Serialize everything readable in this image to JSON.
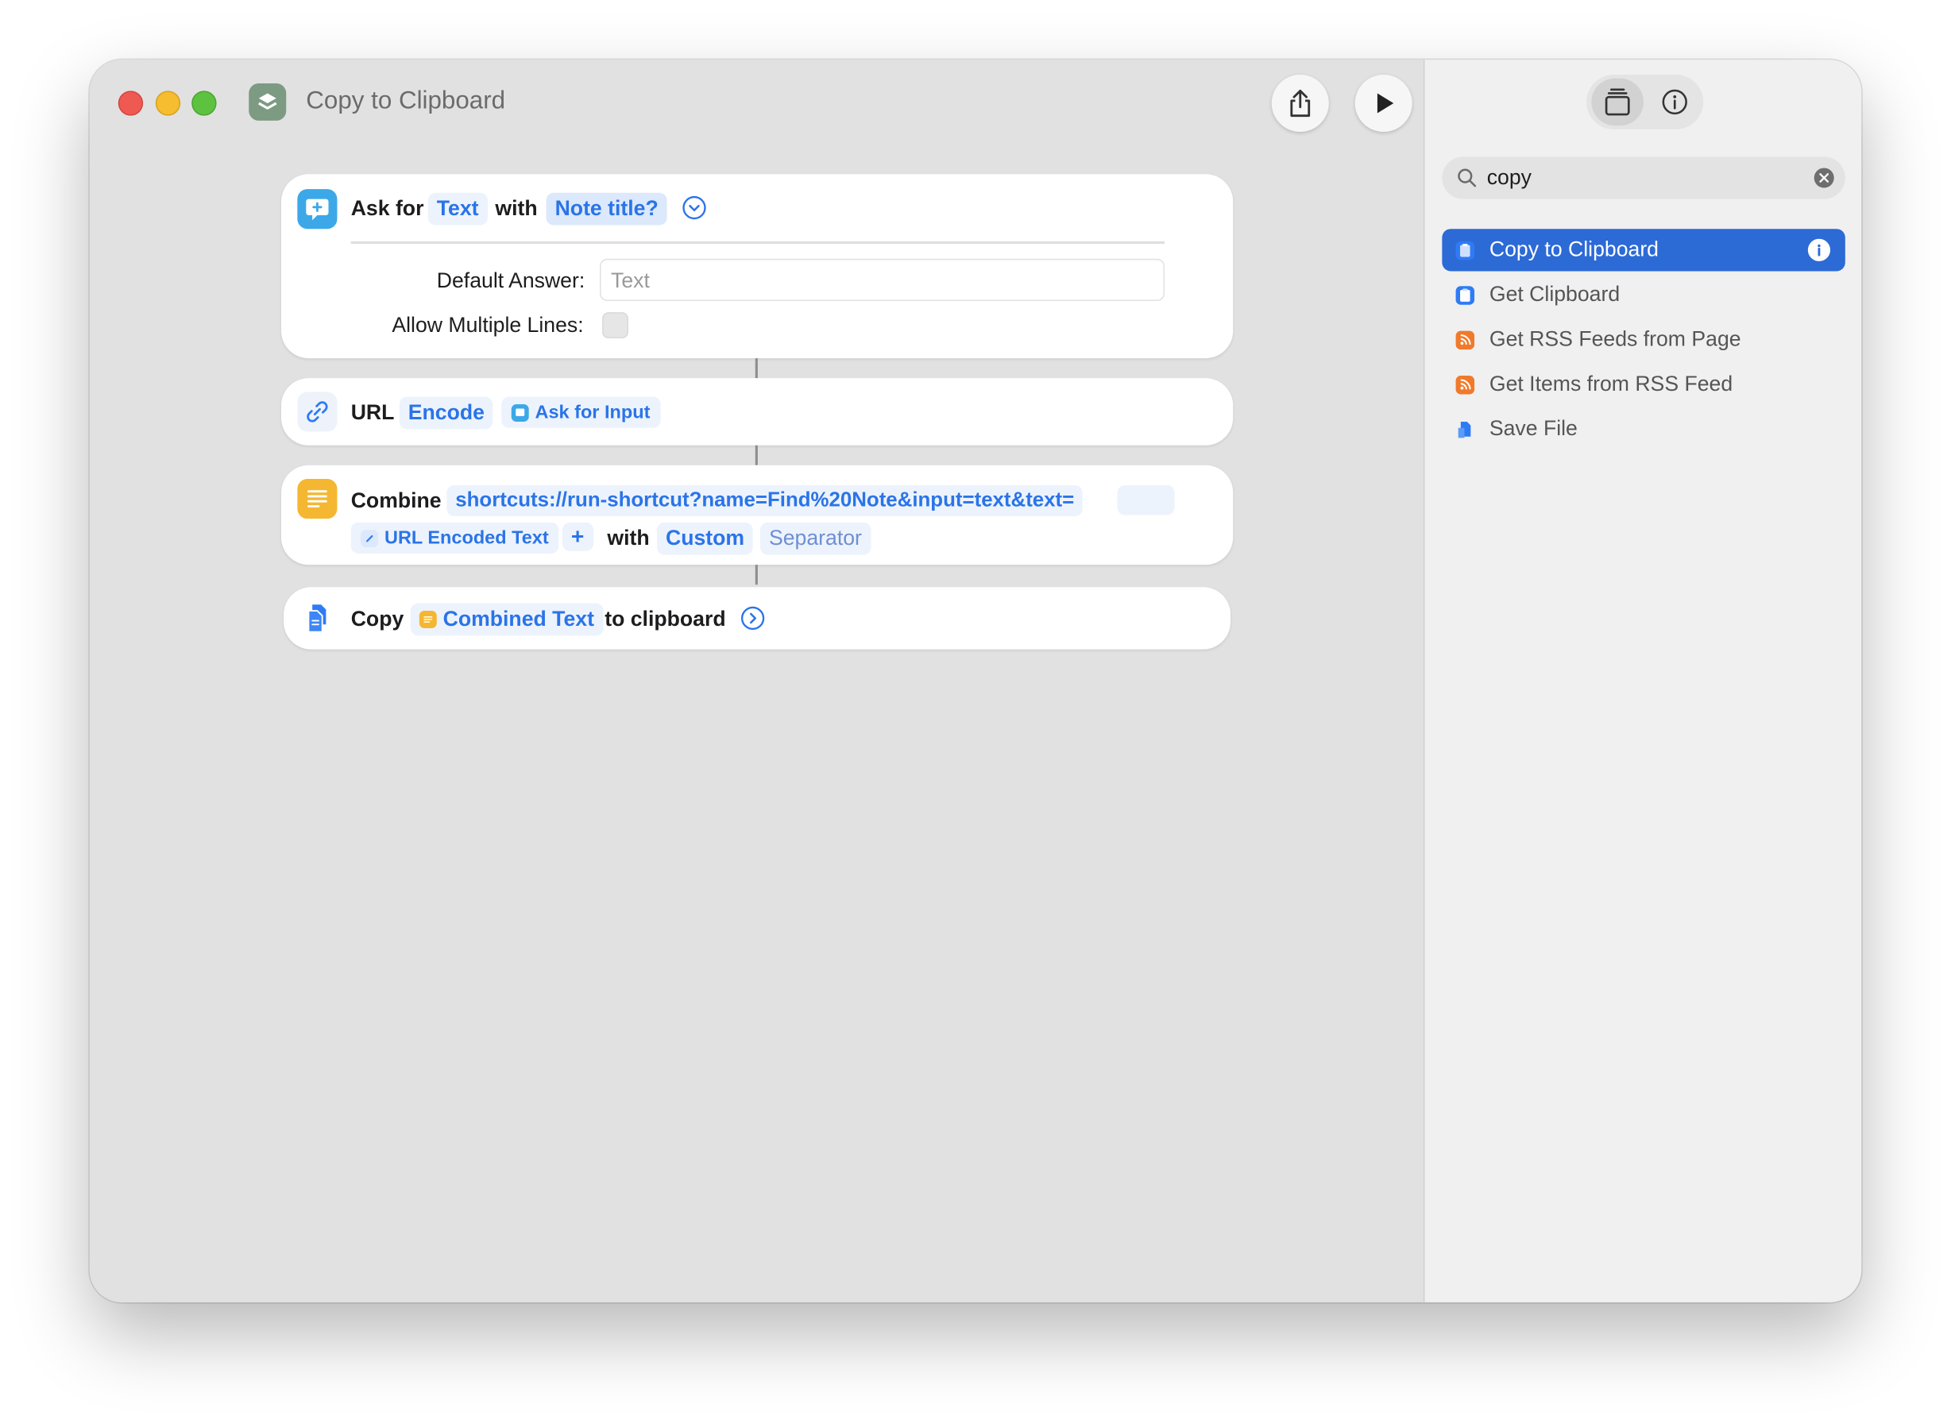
{
  "window": {
    "title": "Copy to Clipboard"
  },
  "actions": {
    "ask": {
      "prefix": "Ask for",
      "type_token": "Text",
      "with_label": "with",
      "prompt_token": "Note title?",
      "default_answer_label": "Default Answer:",
      "default_answer_placeholder": "Text",
      "allow_multiple_label": "Allow Multiple Lines:"
    },
    "url": {
      "prefix": "URL",
      "mode_token": "Encode",
      "input_token": "Ask for Input"
    },
    "combine": {
      "prefix": "Combine",
      "url_token": "shortcuts://run-shortcut?name=Find%20Note&input=text&text=",
      "var_token": "URL Encoded Text",
      "plus": "+",
      "with_label": "with",
      "sep_token": "Custom",
      "sep_placeholder": "Separator"
    },
    "copy": {
      "prefix": "Copy",
      "var_token": "Combined Text",
      "suffix": "to clipboard"
    }
  },
  "sidebar": {
    "search_value": "copy",
    "results": [
      {
        "label": "Copy to Clipboard",
        "icon": "clipboard-icon",
        "color": "#2f7bf5",
        "selected": true
      },
      {
        "label": "Get Clipboard",
        "icon": "clipboard-icon",
        "color": "#2f7bf5",
        "selected": false
      },
      {
        "label": "Get RSS Feeds from Page",
        "icon": "rss-icon",
        "color": "#f07a2b",
        "selected": false
      },
      {
        "label": "Get Items from RSS Feed",
        "icon": "rss-icon",
        "color": "#f07a2b",
        "selected": false
      },
      {
        "label": "Save File",
        "icon": "file-icon",
        "color": "#2f7bf5",
        "selected": false
      }
    ]
  },
  "colors": {
    "accent": "#2a74e8",
    "selection": "#2c6ad6",
    "combine_icon": "#f5b731",
    "ask_icon": "#3ca8e8"
  }
}
